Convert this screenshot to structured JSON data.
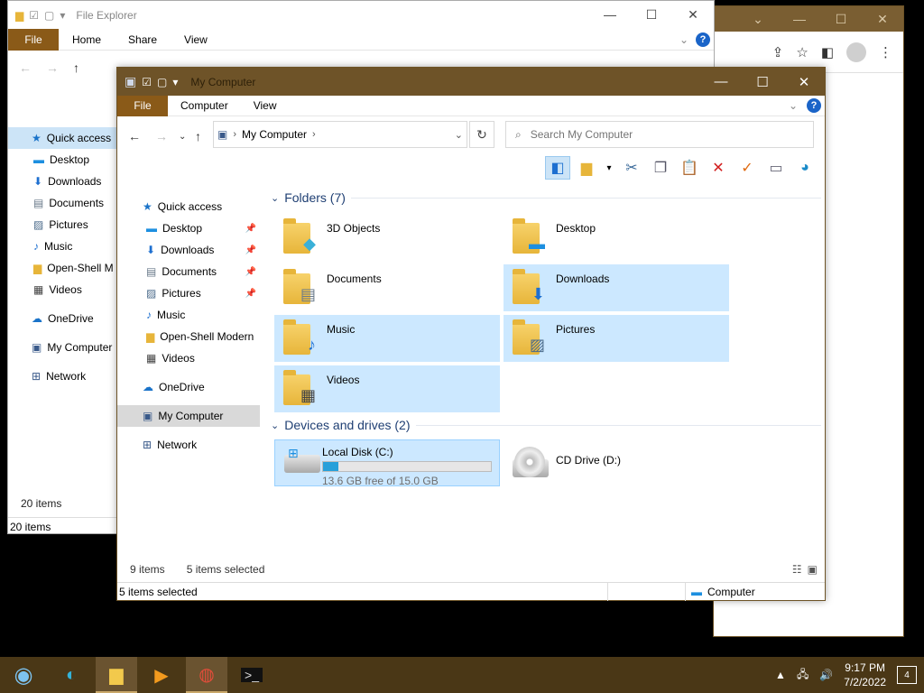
{
  "colors": {
    "accent_file_tab": "#8a5a18",
    "titlebar": "#6e5328",
    "selection": "#cce8ff",
    "taskbar": "#4a3716",
    "group_header": "#1f3f73",
    "progress": "#26a0da"
  },
  "back_window": {
    "title": "File Explorer",
    "ribbon": {
      "file": "File",
      "tabs": [
        "Home",
        "Share",
        "View"
      ]
    },
    "nav": [
      "Quick access",
      "Desktop",
      "Downloads",
      "Documents",
      "Pictures",
      "Music",
      "Open-Shell M",
      "Videos",
      "OneDrive",
      "My Computer",
      "Network"
    ],
    "status_top": "20 items",
    "status_bottom": "20 items"
  },
  "main_window": {
    "title": "My Computer",
    "ribbon": {
      "file": "File",
      "tabs": [
        "Computer",
        "View"
      ]
    },
    "address": {
      "crumb": "My Computer",
      "separator": "›"
    },
    "search": {
      "placeholder": "Search My Computer"
    },
    "nav": {
      "quick_access": "Quick access",
      "items": [
        "Desktop",
        "Downloads",
        "Documents",
        "Pictures",
        "Music",
        "Open-Shell Modern",
        "Videos"
      ],
      "onedrive": "OneDrive",
      "my_computer": "My Computer",
      "network": "Network"
    },
    "folders_header": "Folders (7)",
    "folders": [
      "3D Objects",
      "Desktop",
      "Documents",
      "Downloads",
      "Music",
      "Pictures",
      "Videos"
    ],
    "drives_header": "Devices and drives (2)",
    "drives": {
      "local": {
        "name": "Local Disk (C:)",
        "free": "13.6 GB free of 15.0 GB",
        "used_fraction": 0.09
      },
      "cd": {
        "name": "CD Drive (D:)"
      }
    },
    "status": {
      "count": "9 items",
      "selected": "5 items selected"
    },
    "bottom": {
      "selected": "5 items selected",
      "location": "Computer"
    }
  },
  "taskbar": {
    "time": "9:17 PM",
    "date": "7/2/2022",
    "notification_count": "4"
  }
}
